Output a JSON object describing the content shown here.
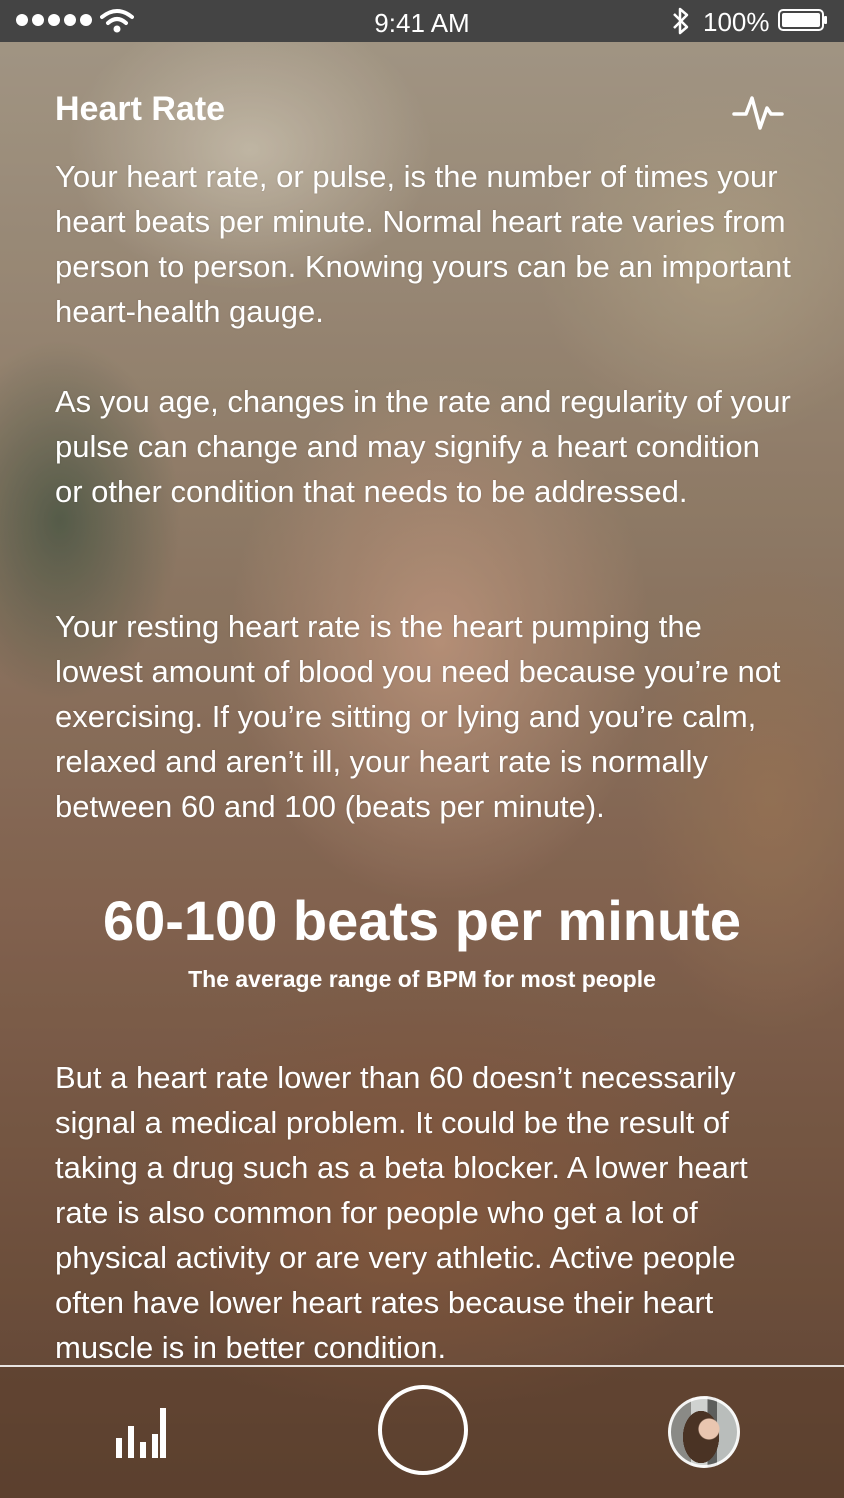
{
  "status_bar": {
    "time": "9:41 AM",
    "battery_percent": "100%",
    "battery_level": 1.0,
    "signal_icon": "signal-dots-icon",
    "wifi_icon": "wifi-icon",
    "bluetooth_icon": "bluetooth-icon"
  },
  "header": {
    "title": "Heart Rate",
    "icon": "pulse-icon"
  },
  "content": {
    "paragraph_1": "Your heart rate, or pulse, is the number of times your heart beats per minute. Normal heart rate varies from person to person. Knowing yours can be an important heart-health gauge.",
    "paragraph_2": "As you age, changes in the rate and regularity of your pulse can change and may signify a heart condition or other condition that needs to be addressed.",
    "paragraph_3": "Your resting heart rate is the heart pumping the lowest amount of blood you need because you’re not exercising. If you’re sitting or lying and you’re calm, relaxed and aren’t ill, your heart rate is normally between 60 and 100 (beats per minute).",
    "highlight_value": "60-100 beats per minute",
    "highlight_caption": "The average range of BPM for most people",
    "paragraph_4": "But a heart rate lower than 60 doesn’t necessarily signal a medical problem. It could be the result of taking a drug such as a beta blocker. A lower heart rate is also common for people who get a lot of physical activity or are very athletic. Active people often have lower heart rates because their heart muscle is in better condition."
  },
  "tab_bar": {
    "stats_icon": "bar-chart-icon",
    "record_icon": "record-circle-icon",
    "profile_icon": "avatar"
  },
  "colors": {
    "text": "#ffffff",
    "status_bar_bg": "#444444"
  }
}
